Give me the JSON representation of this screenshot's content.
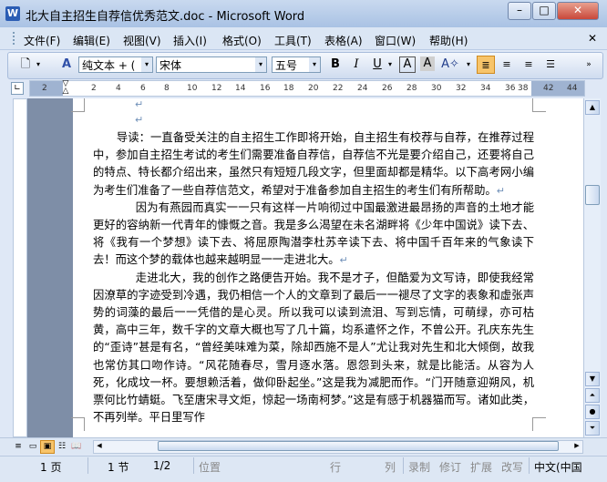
{
  "window": {
    "title": "北大自主招生自荐信优秀范文.doc - Microsoft Word",
    "app_icon": "W",
    "controls": [
      "–",
      "□",
      "✕"
    ]
  },
  "menu": {
    "items": [
      "文件(F)",
      "编辑(E)",
      "视图(V)",
      "插入(I)",
      "格式(O)",
      "工具(T)",
      "表格(A)",
      "窗口(W)",
      "帮助(H)"
    ]
  },
  "toolbar": {
    "style_value": "纯文本 + (",
    "font_value": "宋体",
    "size_value": "五号",
    "bold": "B",
    "italic": "I",
    "underline": "U",
    "font_color_label": "A",
    "char_border_label": "A"
  },
  "ruler": {
    "numbers": [
      "2",
      "2",
      "4",
      "6",
      "8",
      "10",
      "12",
      "14",
      "16",
      "18",
      "20",
      "22",
      "24",
      "26",
      "28",
      "30",
      "32",
      "34",
      "36",
      "38",
      "42",
      "44"
    ]
  },
  "document": {
    "paragraphs": [
      "导读：一直备受关注的自主招生工作即将开始，自主招生有校荐与自荐，在推荐过程中，参加自主招生考试的考生们需要准备自荐信，自荐信不光是要介绍自己，还要将自己的特点、特长都介绍出来，虽然只有短短几段文字，但里面却都是精华。以下高考网小编为考生们准备了一些自荐信范文，希望对于准备参加自主招生的考生们有所帮助。",
      "因为有燕园而真实一一只有这样一片响彻过中国最激进最昂扬的声音的土地才能更好的容纳新一代青年的慷慨之音。我是多么渴望在未名湖畔将《少年中国说》读下去、将《我有一个梦想》读下去、将屈原陶潜李杜苏辛读下去、将中国千百年来的气象读下去！而这个梦的载体也越来越明显一一走进北大。",
      "走进北大，我的创作之路便告开始。我不是才子，但酷爱为文写诗，即使我经常因潦草的字迹受到冷遇，我仍相信一个人的文章到了最后一一褪尽了文字的表象和虚张声势的词藻的最后一一凭借的是心灵。所以我可以读到流泪、写到忘情，可萌绿，亦可枯黄，高中三年，数千字的文章大概也写了几十篇，均系遣怀之作，不曾公开。孔庆东先生的“歪诗”甚是有名，“曾经美味难为菜，除却西施不是人”尤让我对先生和北大倾倒，故我也常仿其口吻作诗。“风花随春尽，雪月逐水落。恩怨到头来，就是比能活。从容为人死，化成坟一杯。要想赖活着，做仰卧起坐。”这是我为减肥而作。“门开随意迎朔风，机票何比竹蜻蜓。飞至唐宋寻文炬，惊起一场南柯梦。”这是有感于机器猫而写。诸如此类，不再列举。平日里写作"
    ],
    "paragraph_mark": "↵"
  },
  "statusbar": {
    "page": "1 页",
    "section": "1 节",
    "page_of": "1/2",
    "position": "位置",
    "line": "行",
    "column": "列",
    "record": "录制",
    "revise": "修订",
    "extend": "扩展",
    "overwrite": "改写",
    "language": "中文(中国"
  },
  "colors": {
    "titlebar": "#b7cbe8",
    "page_bg": "#7e8ea7",
    "para_mark": "#6f8fb8"
  }
}
